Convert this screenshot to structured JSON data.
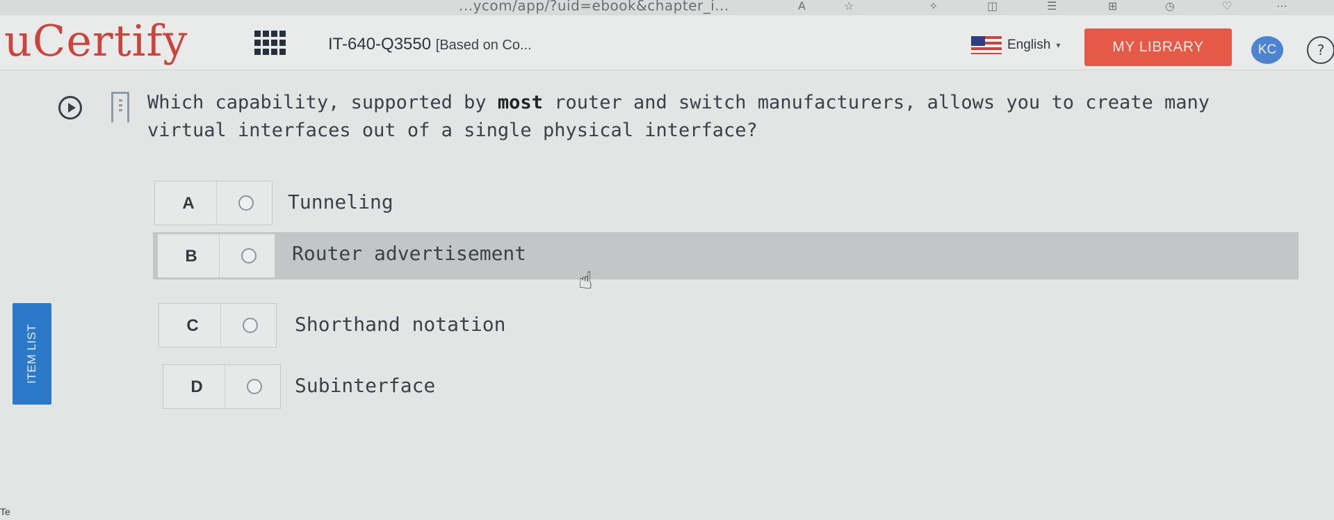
{
  "browser": {
    "url_fragment": "...ycom/app/?uid=ebook&chapter_i...",
    "toolbar_icons": [
      "font-icon",
      "favorite-star-icon",
      "extensions-icon",
      "split-screen-icon",
      "favorites-list-icon",
      "collections-icon",
      "history-icon",
      "browser-essentials-icon",
      "more-icon"
    ]
  },
  "header": {
    "logo": "uCertify",
    "apps_icon": "grid-icon",
    "course_code": "IT-640-Q3550",
    "course_sub": "[Based on Co...",
    "language": "English",
    "language_caret": "▾",
    "my_library": "MY LIBRARY",
    "avatar_initials": "KC",
    "help": "?"
  },
  "question": {
    "text_before": "Which capability, supported by ",
    "text_bold": "most",
    "text_after": " router and switch manufacturers, allows you to create many virtual interfaces out of a single physical interface?"
  },
  "options": [
    {
      "letter": "A",
      "text": "Tunneling"
    },
    {
      "letter": "B",
      "text": "Router advertisement"
    },
    {
      "letter": "C",
      "text": "Shorthand notation"
    },
    {
      "letter": "D",
      "text": "Subinterface"
    }
  ],
  "hovered_option": "B",
  "sidebar": {
    "item_list_label": "ITEM LIST"
  },
  "edge_fragment": "Te",
  "colors": {
    "brand_red": "#c9453e",
    "my_library_bg": "#e45a47",
    "avatar_bg": "#4d84cf",
    "item_list_bg": "#2d79c9",
    "hover_row_bg": "#c3c6c6"
  }
}
